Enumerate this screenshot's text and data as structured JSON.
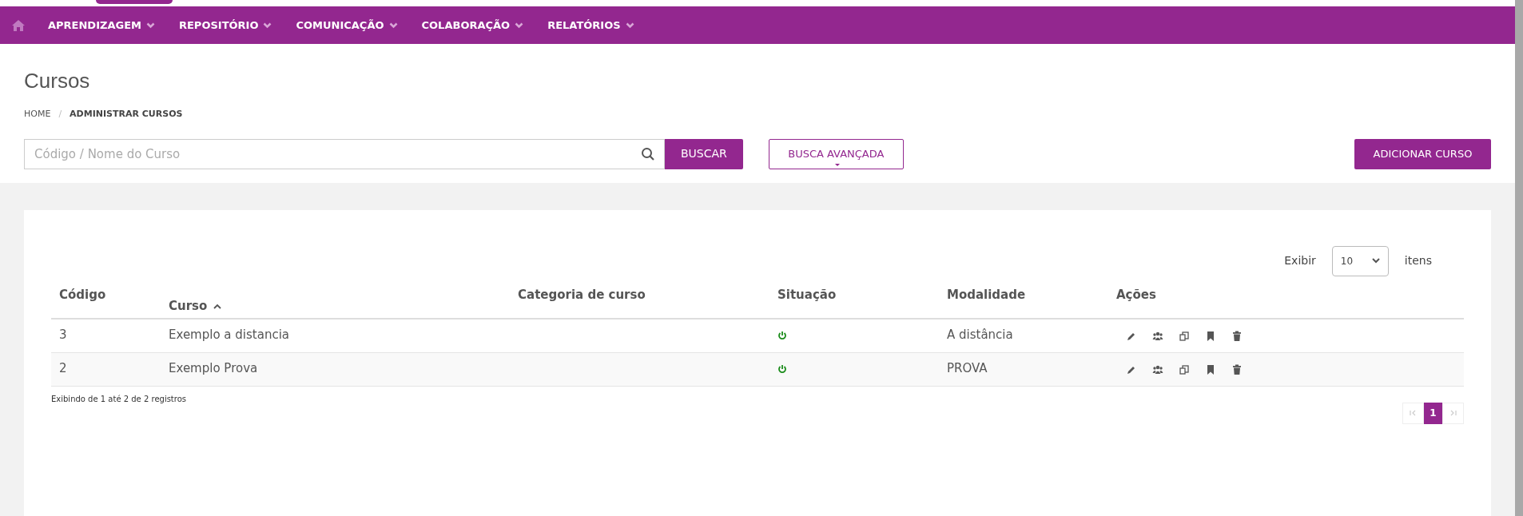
{
  "nav": {
    "items": [
      {
        "label": "APRENDIZAGEM"
      },
      {
        "label": "REPOSITÓRIO"
      },
      {
        "label": "COMUNICAÇÃO"
      },
      {
        "label": "COLABORAÇÃO"
      },
      {
        "label": "RELATÓRIOS"
      }
    ]
  },
  "page": {
    "title": "Cursos",
    "separator": "/",
    "breadcrumb": [
      {
        "label": "HOME",
        "current": false
      },
      {
        "label": "ADMINISTRAR CURSOS",
        "current": true
      }
    ]
  },
  "search": {
    "placeholder": "Código / Nome do Curso",
    "button": "BUSCAR",
    "advanced": "BUSCA AVANÇADA",
    "add": "ADICIONAR CURSO"
  },
  "page_size": {
    "label": "Exibir",
    "value": "10",
    "suffix": "itens"
  },
  "table": {
    "columns": [
      {
        "label": "Código",
        "sorted": false
      },
      {
        "label": "Curso",
        "sorted": true
      },
      {
        "label": "Categoria de curso",
        "sorted": false
      },
      {
        "label": "Situação",
        "sorted": false
      },
      {
        "label": "Modalidade",
        "sorted": false
      },
      {
        "label": "Ações",
        "sorted": false
      }
    ],
    "rows": [
      {
        "code": "3",
        "course": "Exemplo a distancia",
        "active": true,
        "mode": "A distância"
      },
      {
        "code": "2",
        "course": "Exemplo Prova",
        "active": true,
        "mode": "PROVA"
      }
    ]
  },
  "footer": "Exibindo de 1 até 2 de 2 registros",
  "pagination": {
    "first_disabled": true,
    "pages": [
      {
        "label": "1",
        "selected": true
      }
    ],
    "last_disabled": true
  }
}
